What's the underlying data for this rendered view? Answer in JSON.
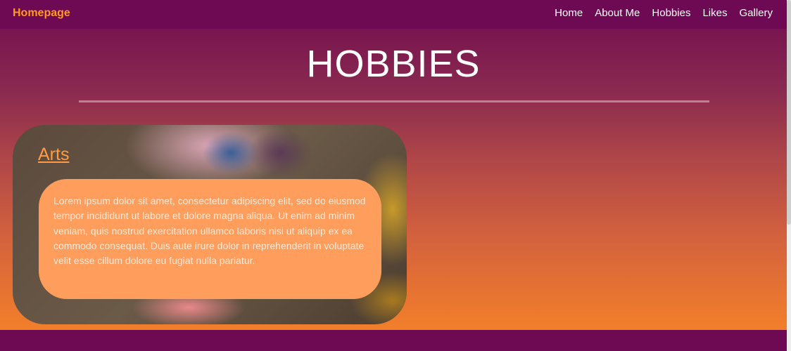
{
  "nav": {
    "brand": "Homepage",
    "links": [
      "Home",
      "About Me",
      "Hobbies",
      "Likes",
      "Gallery"
    ]
  },
  "page": {
    "title": "HOBBIES"
  },
  "card": {
    "heading": "Arts",
    "text": "Lorem ipsum dolor sit amet, consectetur adipiscing elit, sed do eiusmod tempor incididunt ut labore et dolore magna aliqua. Ut enim ad minim veniam, quis nostrud exercitation ullamco laboris nisi ut aliquip ex ea commodo consequat. Duis aute irure dolor in reprehenderit in voluptate velit esse cillum dolore eu fugiat nulla pariatur."
  },
  "colors": {
    "nav": "#6e0954",
    "brand": "#ff9a1f",
    "text_box": "#ff9d5c"
  }
}
